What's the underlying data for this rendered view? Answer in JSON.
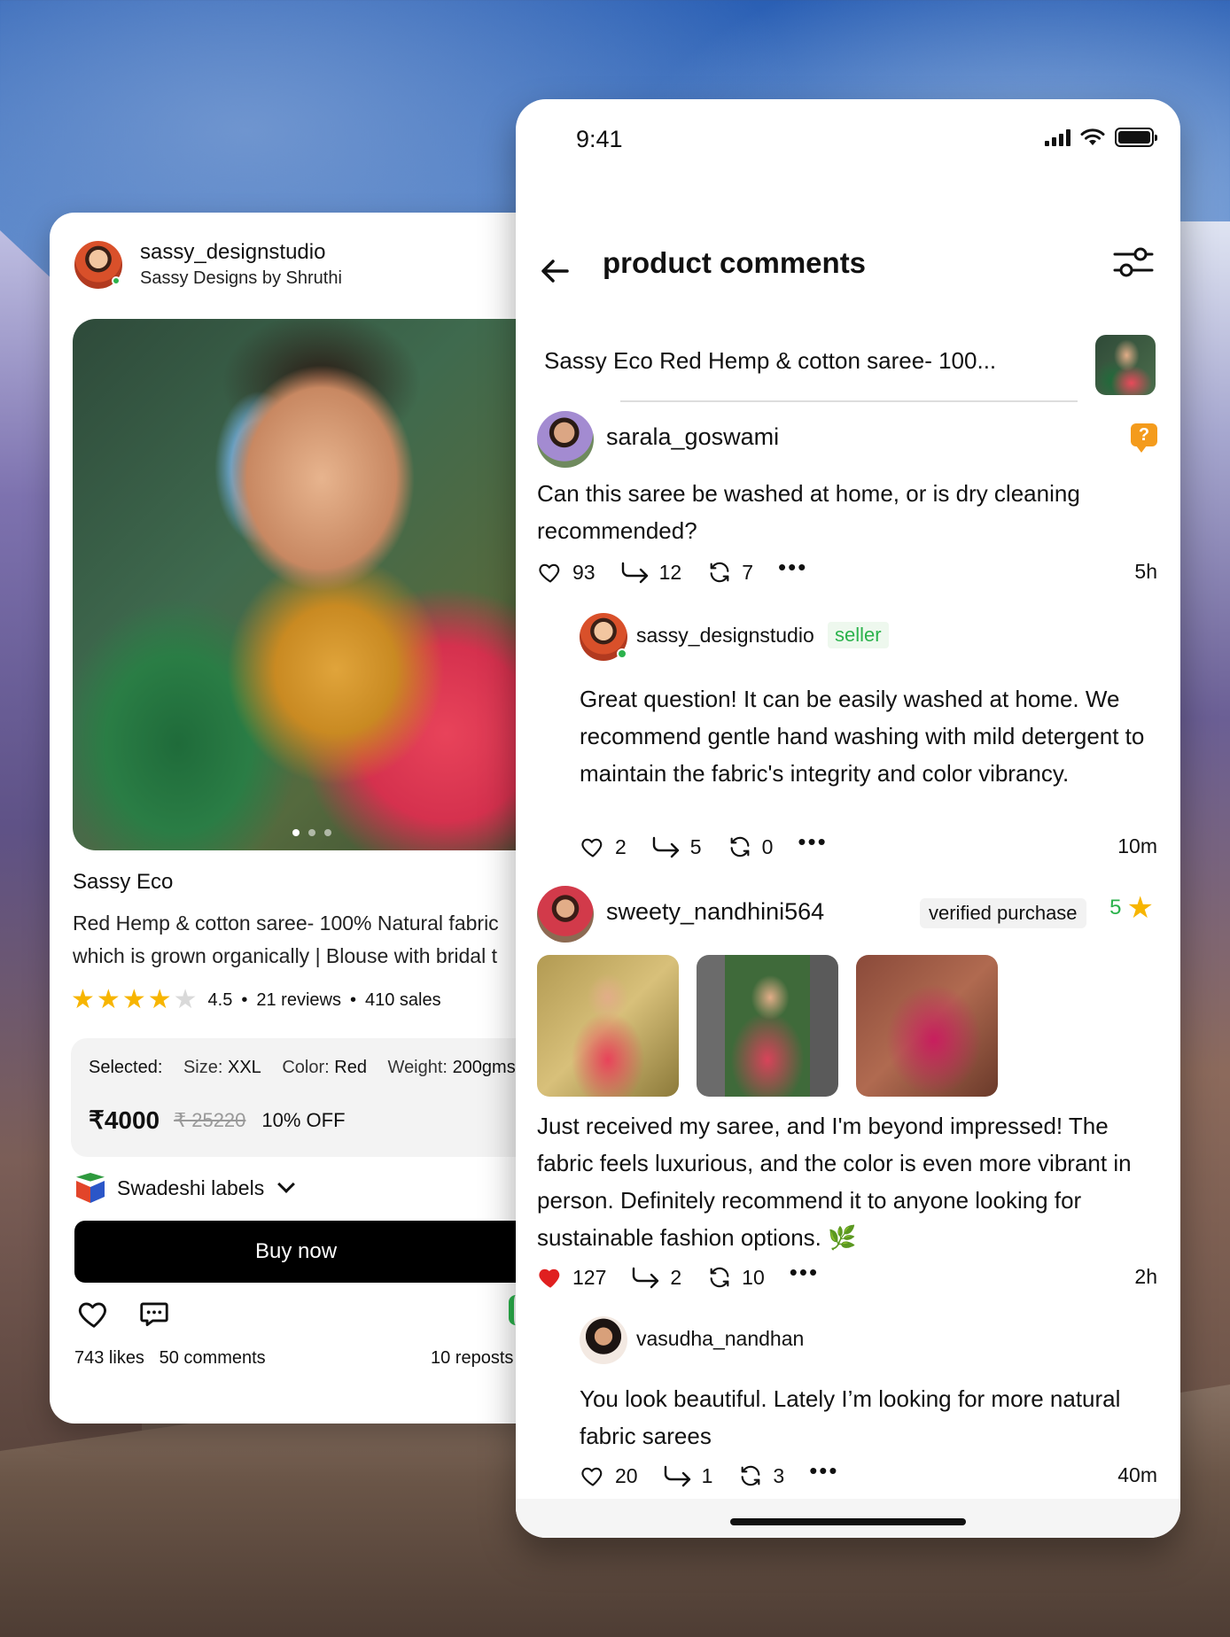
{
  "product_card": {
    "shop_handle": "sassy_designstudio",
    "shop_display_name": "Sassy Designs by Shruthi",
    "brand": "Sassy Eco",
    "description_line1": "Red Hemp & cotton saree- 100% Natural fabric",
    "description_line2": "which is grown organically | Blouse with bridal t",
    "rating": "4.5",
    "rating_stars": 4,
    "reviews": "21 reviews",
    "sales": "410 sales",
    "separator": "•",
    "selected_label": "Selected:",
    "size_label": "Size:",
    "size_value": "XXL",
    "color_label": "Color:",
    "color_value": "Red",
    "weight_label": "Weight:",
    "weight_value": "200gms",
    "price": "₹4000",
    "price_original": "₹ 25220",
    "discount": "10% OFF",
    "labels_text": "Swadeshi labels",
    "buy_label": "Buy now",
    "likes": "743 likes",
    "comments": "50 comments",
    "reposts": "10 reposts"
  },
  "phone": {
    "time": "9:41",
    "title": "product comments",
    "product_brand": "Sassy Eco",
    "product_title": "Red Hemp & cotton saree- 100...",
    "comments": [
      {
        "user": "sarala_goswami",
        "text": "Can this saree be washed at home, or is dry cleaning recommended?",
        "likes": "93",
        "replies": "12",
        "reposts": "7",
        "ago": "5h",
        "badge_icon": "question-badge-icon",
        "badge_text": "?"
      },
      {
        "user": "sassy_designstudio",
        "role": "seller",
        "text": "Great question! It can be easily washed at home. We recommend gentle hand washing with mild detergent to maintain the fabric's integrity and color vibrancy.",
        "likes": "2",
        "replies": "5",
        "reposts": "0",
        "ago": "10m"
      },
      {
        "user": "sweety_nandhini564",
        "badge": "verified purchase",
        "stars": "5",
        "text": "Just received my saree, and I'm beyond impressed! The fabric feels luxurious, and the color is even more vibrant in person. Definitely recommend it to anyone looking for sustainable fashion options. 🌿",
        "likes": "127",
        "liked": true,
        "replies": "2",
        "reposts": "10",
        "ago": "2h"
      },
      {
        "user": "vasudha_nandhan",
        "text": "You look beautiful. Lately I’m looking for more natural fabric sarees",
        "likes": "20",
        "replies": "1",
        "reposts": "3",
        "ago": "40m"
      }
    ],
    "more_glyph": "•••"
  },
  "colors": {
    "accent_green": "#2bb24c",
    "star_gold": "#f7b500",
    "like_red": "#e02020",
    "question_orange": "#f49b1c"
  }
}
